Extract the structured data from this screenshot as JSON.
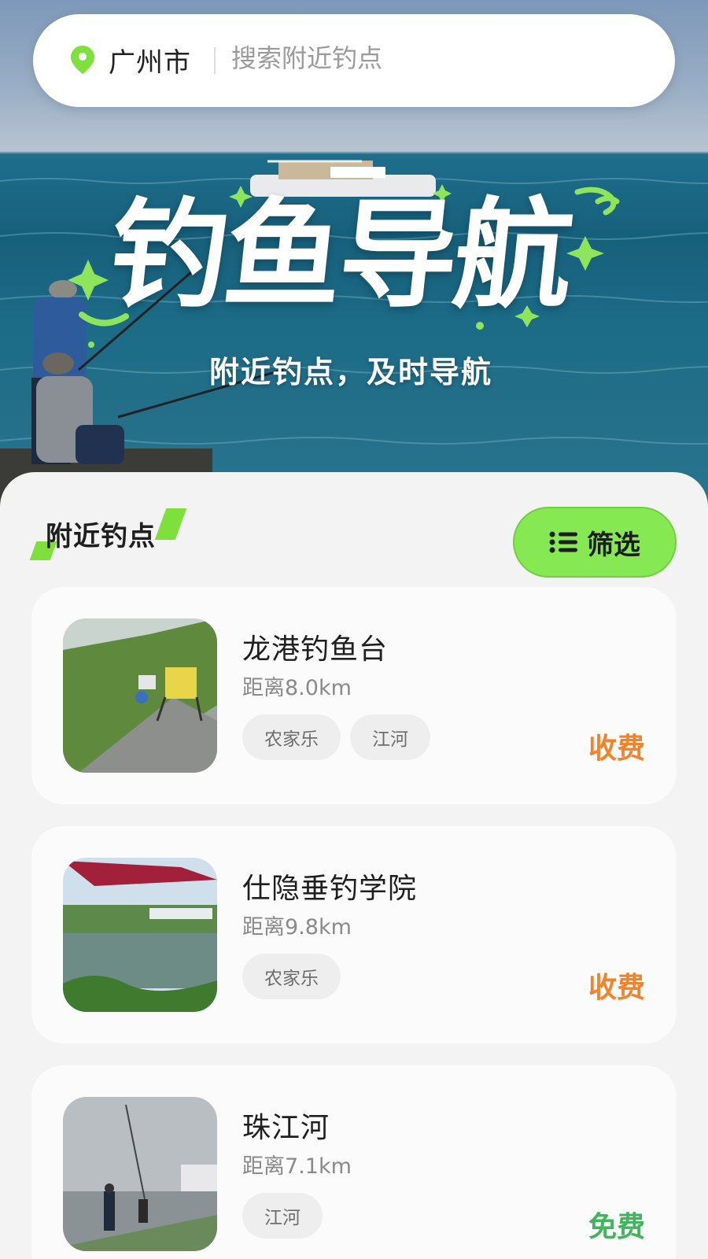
{
  "search": {
    "city": "广州市",
    "placeholder": "搜索附近钓点"
  },
  "hero": {
    "title": "钓鱼导航",
    "subtitle": "附近钓点，及时导航"
  },
  "section": {
    "title": "附近钓点",
    "filter_label": "筛选",
    "filter_icon": "list-icon"
  },
  "spots": [
    {
      "name": "龙港钓鱼台",
      "distance": "距离8.0km",
      "tags": [
        "农家乐",
        "江河"
      ],
      "price": "收费"
    },
    {
      "name": "仕隐垂钓学院",
      "distance": "距离9.8km",
      "tags": [
        "农家乐"
      ],
      "price": "收费"
    },
    {
      "name": "珠江河",
      "distance": "距离7.1km",
      "tags": [
        "江河"
      ],
      "price": "免费"
    }
  ],
  "colors": {
    "accent_green": "#86e954",
    "paid": "#f0832c",
    "free": "#3fb55c"
  }
}
